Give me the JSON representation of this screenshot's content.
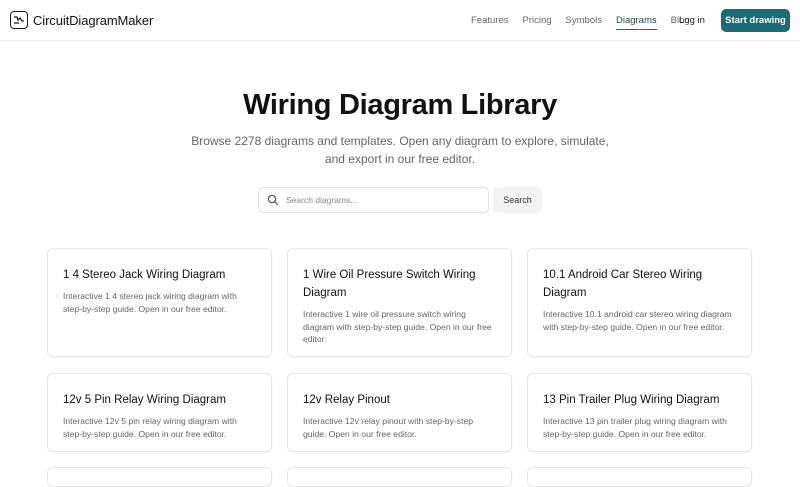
{
  "header": {
    "brand": "CircuitDiagramMaker",
    "nav": [
      {
        "label": "Features",
        "active": false
      },
      {
        "label": "Pricing",
        "active": false
      },
      {
        "label": "Symbols",
        "active": false
      },
      {
        "label": "Diagrams",
        "active": true
      },
      {
        "label": "Blog",
        "active": false
      }
    ],
    "login_label": "Log in",
    "cta_label": "Start drawing",
    "accent_color": "#1e6a75"
  },
  "hero": {
    "title": "Wiring Diagram Library",
    "subtitle": "Browse 2278 diagrams and templates. Open any diagram to explore, simulate, and export in our free editor."
  },
  "search": {
    "placeholder": "Search diagrams...",
    "button_label": "Search"
  },
  "cards": [
    {
      "title": "1 4 Stereo Jack Wiring Diagram",
      "description": "Interactive 1 4 stereo jack wiring diagram with step-by-step guide. Open in our free editor."
    },
    {
      "title": "1 Wire Oil Pressure Switch Wiring Diagram",
      "description": "Interactive 1 wire oil pressure switch wiring diagram with step-by-step guide. Open in our free editor."
    },
    {
      "title": "10.1 Android Car Stereo Wiring Diagram",
      "description": "Interactive 10.1 android car stereo wiring diagram with step-by-step guide. Open in our free editor."
    },
    {
      "title": "12v 5 Pin Relay Wiring Diagram",
      "description": "Interactive 12v 5 pin relay wiring diagram with step-by-step guide. Open in our free editor."
    },
    {
      "title": "12v Relay Pinout",
      "description": "Interactive 12v relay pinout with step-by-step guide. Open in our free editor."
    },
    {
      "title": "13 Pin Trailer Plug Wiring Diagram",
      "description": "Interactive 13 pin trailer plug wiring diagram with step-by-step guide. Open in our free editor."
    }
  ]
}
